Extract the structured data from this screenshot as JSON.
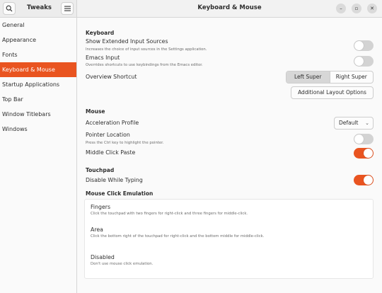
{
  "header": {
    "app_title": "Tweaks",
    "window_title": "Keyboard & Mouse",
    "search_icon": "search-icon",
    "menu_icon": "hamburger-menu-icon",
    "window_controls": {
      "minimize": "–",
      "maximize": "▫",
      "close": "✕"
    }
  },
  "sidebar": {
    "items": [
      {
        "label": "General",
        "active": false
      },
      {
        "label": "Appearance",
        "active": false
      },
      {
        "label": "Fonts",
        "active": false
      },
      {
        "label": "Keyboard & Mouse",
        "active": true
      },
      {
        "label": "Startup Applications",
        "active": false
      },
      {
        "label": "Top Bar",
        "active": false
      },
      {
        "label": "Window Titlebars",
        "active": false
      },
      {
        "label": "Windows",
        "active": false
      }
    ]
  },
  "keyboard": {
    "section": "Keyboard",
    "extended_sources": {
      "label": "Show Extended Input Sources",
      "desc": "Increases the choice of input sources in the Settings application.",
      "on": false
    },
    "emacs": {
      "label": "Emacs Input",
      "desc": "Overrides shortcuts to use keybindings from the Emacs editor.",
      "on": false
    },
    "overview": {
      "label": "Overview Shortcut",
      "left": "Left Super",
      "right": "Right Super",
      "selected": "Left Super"
    },
    "additional_layout": "Additional Layout Options"
  },
  "mouse": {
    "section": "Mouse",
    "accel": {
      "label": "Acceleration Profile",
      "value": "Default"
    },
    "pointer_location": {
      "label": "Pointer Location",
      "desc": "Press the Ctrl key to highlight the pointer.",
      "on": false
    },
    "middle_click": {
      "label": "Middle Click Paste",
      "on": true
    }
  },
  "touchpad": {
    "section": "Touchpad",
    "disable_typing": {
      "label": "Disable While Typing",
      "on": true
    }
  },
  "emulation": {
    "section": "Mouse Click Emulation",
    "options": [
      {
        "title": "Fingers",
        "desc": "Click the touchpad with two fingers for right-click and three fingers for middle-click."
      },
      {
        "title": "Area",
        "desc": "Click the bottom right of the touchpad for right-click and the bottom middle for middle-click."
      },
      {
        "title": "Disabled",
        "desc": "Don't use mouse click emulation."
      }
    ]
  },
  "colors": {
    "accent": "#e95420",
    "toggle_off": "#d3d3d3"
  }
}
